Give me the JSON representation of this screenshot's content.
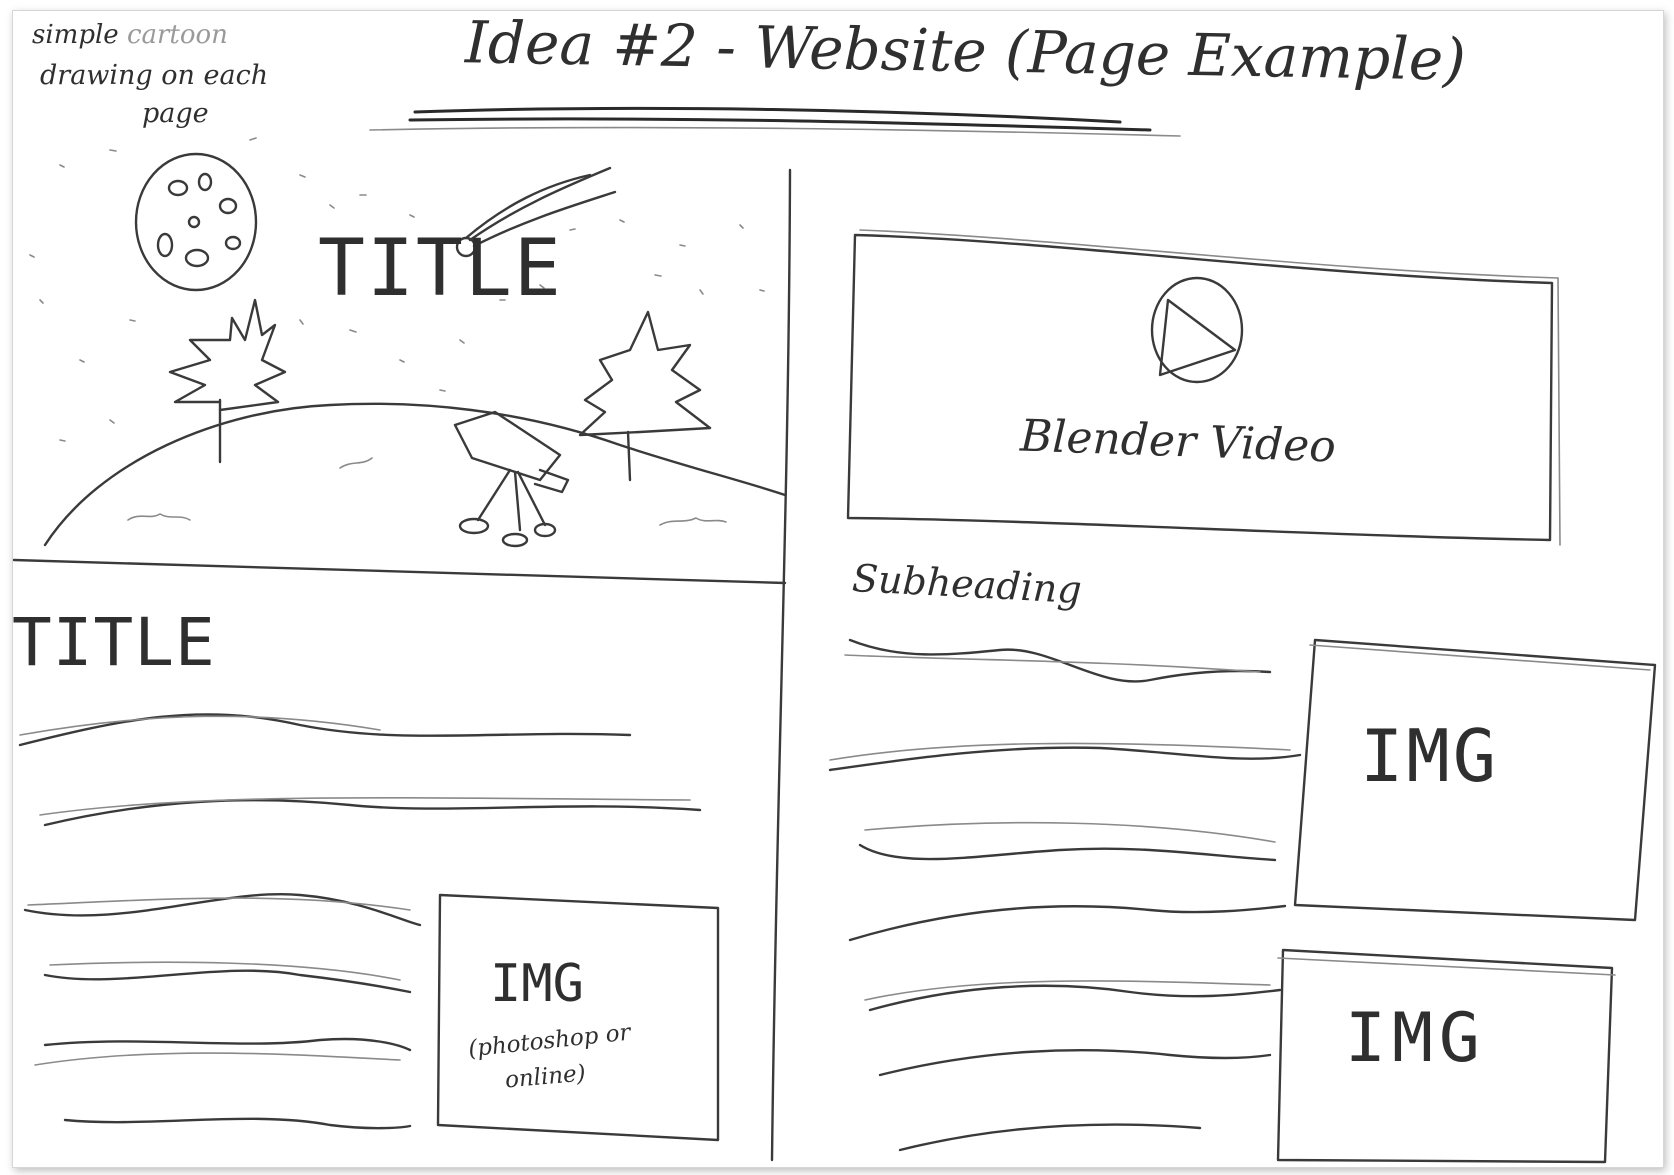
{
  "heading": {
    "title": "Idea #2 - Website (Page Example)"
  },
  "annotation": {
    "line1": "simple",
    "line1_faint": "cartoon",
    "line2": "drawing on each",
    "line3": "page"
  },
  "hero": {
    "title": "TITLE"
  },
  "left_column": {
    "title": "TITLE",
    "image": {
      "label": "IMG",
      "caption_line1": "(photoshop or",
      "caption_line2": "online)"
    }
  },
  "right_column": {
    "video": {
      "label": "Blender Video",
      "icon": "play-icon"
    },
    "subheading": "Subheading",
    "image_1": {
      "label": "IMG"
    },
    "image_2": {
      "label": "IMG"
    }
  },
  "colors": {
    "paper": "#ffffff",
    "pencil": "#3a3a3a",
    "pencil_light": "#8a8a8a"
  }
}
